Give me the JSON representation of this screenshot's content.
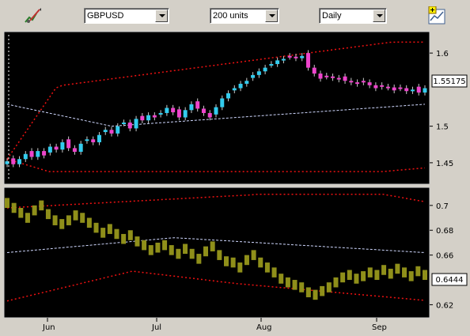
{
  "toolbar": {
    "drawing_tool_icon": "pencil-chart-icon",
    "symbol": "GBPUSD",
    "units": "200 units",
    "interval": "Daily",
    "add_indicator_icon": "add-chart-icon"
  },
  "chart_data": [
    {
      "type": "candlestick",
      "ylim": [
        1.425,
        1.625
      ],
      "y_ticks": [
        "1.6",
        "1.5",
        "1.45"
      ],
      "price_label": "1.55175",
      "x_ticks": [
        "Jun",
        "Jul",
        "Aug",
        "Sep"
      ],
      "colors": {
        "up": "#33ccee",
        "down": "#ee44cc",
        "upper_band": "#ee1111",
        "lower_band": "#ee1111",
        "mid_line": "#d0d8ff"
      },
      "close": [
        1.452,
        1.448,
        1.455,
        1.462,
        1.458,
        1.466,
        1.46,
        1.472,
        1.468,
        1.478,
        1.47,
        1.465,
        1.476,
        1.482,
        1.478,
        1.488,
        1.495,
        1.49,
        1.5,
        1.505,
        1.497,
        1.51,
        1.508,
        1.515,
        1.512,
        1.518,
        1.525,
        1.519,
        1.512,
        1.522,
        1.53,
        1.524,
        1.518,
        1.512,
        1.526,
        1.538,
        1.545,
        1.552,
        1.558,
        1.562,
        1.57,
        1.575,
        1.58,
        1.585,
        1.59,
        1.592,
        1.595,
        1.593,
        1.596,
        1.58,
        1.572,
        1.565,
        1.568,
        1.566,
        1.564,
        1.562,
        1.56,
        1.558,
        1.56,
        1.556,
        1.552,
        1.554,
        1.553,
        1.549,
        1.552,
        1.548,
        1.55,
        1.546,
        1.552
      ],
      "upper_band_trend": "wide envelope rising from 1.455 to 1.615",
      "lower_band_trend": "from 1.455 down to 1.438 then back up to 1.443"
    },
    {
      "type": "bar",
      "ylim": [
        0.612,
        0.712
      ],
      "y_ticks": [
        "0.7",
        "0.68",
        "0.66",
        "0.62"
      ],
      "value_label": "0.6444",
      "bar_color": "#8f8f1a",
      "values": [
        0.702,
        0.698,
        0.694,
        0.69,
        0.696,
        0.7,
        0.693,
        0.688,
        0.685,
        0.688,
        0.692,
        0.69,
        0.686,
        0.682,
        0.678,
        0.681,
        0.677,
        0.673,
        0.676,
        0.671,
        0.668,
        0.664,
        0.666,
        0.668,
        0.664,
        0.661,
        0.665,
        0.661,
        0.657,
        0.663,
        0.667,
        0.66,
        0.655,
        0.654,
        0.65,
        0.656,
        0.66,
        0.654,
        0.65,
        0.646,
        0.641,
        0.638,
        0.636,
        0.634,
        0.63,
        0.628,
        0.631,
        0.634,
        0.638,
        0.642,
        0.644,
        0.641,
        0.643,
        0.646,
        0.644,
        0.648,
        0.645,
        0.649,
        0.646,
        0.643,
        0.647,
        0.644
      ],
      "upper_band_trend": "from 0.698 up to 0.71, ending 0.703",
      "lower_band_trend": "from 0.623 to 0.647 then down to 0.623"
    }
  ]
}
